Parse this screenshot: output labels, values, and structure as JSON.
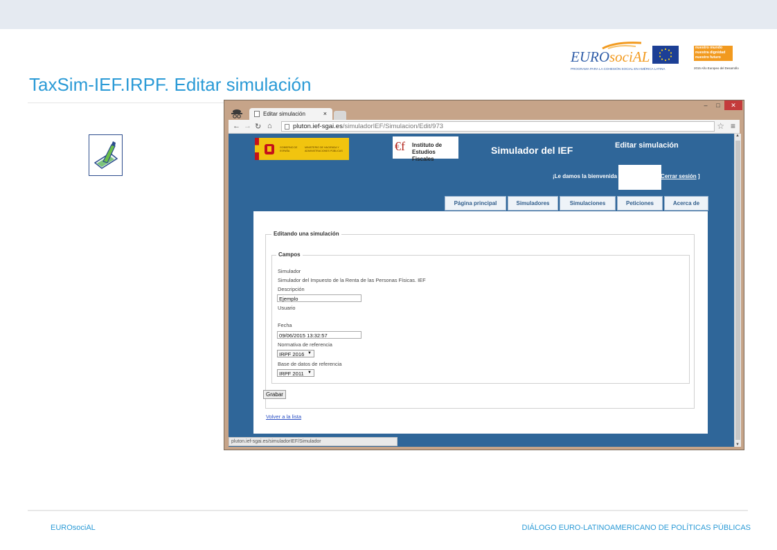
{
  "slide": {
    "title": "TaxSim-IEF.IRPF. Editar simulación",
    "footer_left": "EUROsociAL",
    "footer_right": "DIÁLOGO EURO-LATINOAMERICANO DE POLÍTICAS PÚBLICAS"
  },
  "logos": {
    "eurosocial_word_a": "EURO",
    "eurosocial_word_b": "sociAL",
    "eurosocial_sub": "PROGRAMA PARA LA COHESIÓN SOCIAL EN AMÉRICA LATINA",
    "nm_lines": [
      "nuestro mundo",
      "nuestra dignidad",
      "nuestro futuro"
    ],
    "nm_year": "2015 Año Europeo del Desarrollo"
  },
  "browser": {
    "tab_title": "Editar simulación",
    "tab_close": "×",
    "url_host": "pluton.ief-sgai.es",
    "url_path": "/simuladorIEF/Simulacion/Edit/973",
    "status_url": "pluton.ief-sgai.es/simuladorIEF/Simulador",
    "win_min": "–",
    "win_max": "□",
    "win_close": "✕"
  },
  "site": {
    "gob_text_1": "GOBIERNO DE ESPAÑA",
    "gob_text_2": "MINISTERIO DE HACIENDA Y ADMINISTRACIONES PÚBLICAS",
    "ief_line1": "Instituto de",
    "ief_line2": "Estudios Fiscales",
    "site_title": "Simulador del IEF",
    "page_heading": "Editar simulación",
    "welcome": "¡Le damos la bienvenida",
    "logout": "[Cerrar sesión",
    "logout_end": "]",
    "nav": [
      {
        "label": "Página principal"
      },
      {
        "label": "Simuladores"
      },
      {
        "label": "Simulaciones"
      },
      {
        "label": "Peticiones"
      },
      {
        "label": "Acerca de"
      }
    ]
  },
  "form": {
    "outer_legend": "Editando una simulación",
    "inner_legend": "Campos",
    "simulador_label": "Simulador",
    "simulador_value": "Simulador del Impuesto de la Renta de las Personas Físicas. IEF",
    "descripcion_label": "Descripción",
    "descripcion_value": "Ejemplo",
    "usuario_label": "Usuario",
    "fecha_label": "Fecha",
    "fecha_value": "09/06/2015 13:32:57",
    "normativa_label": "Normativa de referencia",
    "normativa_value": "IRPF 2016",
    "base_label": "Base de datos de referencia",
    "base_value": "IRPF 2011",
    "save_label": "Grabar",
    "back_link": "Volver a la lista"
  },
  "colors": {
    "accent": "#2a9ad6",
    "site_bg": "#2f6699",
    "browser_frame": "#c6a489"
  }
}
